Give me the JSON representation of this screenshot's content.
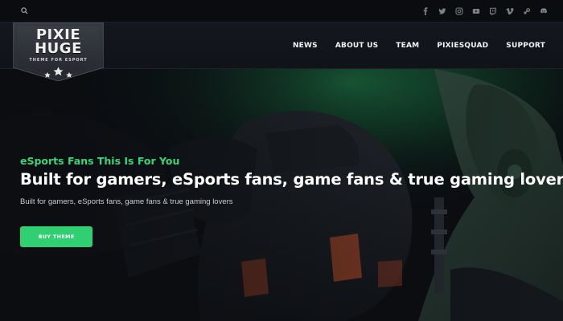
{
  "topbar": {
    "search_icon": "search-icon",
    "socials": [
      "facebook-icon",
      "twitter-icon",
      "instagram-icon",
      "youtube-icon",
      "twitch-icon",
      "vimeo-icon",
      "steam-icon",
      "discord-icon"
    ]
  },
  "logo": {
    "line1": "PIXIE",
    "line2": "HUGE",
    "tagline": "THEME FOR ESPORT"
  },
  "nav": {
    "items": [
      "NEWS",
      "ABOUT US",
      "TEAM",
      "PIXIESQUAD",
      "SUPPORT"
    ]
  },
  "hero": {
    "eyebrow": "eSports Fans This Is For You",
    "headline": "Built for gamers, eSports fans, game fans & true gaming lovers",
    "subline": "Built for gamers, eSports fans, game fans & true gaming lovers",
    "cta_label": "BUY THEME"
  },
  "colors": {
    "accent": "#2fcf72",
    "background": "#0d0f13",
    "header": "#14171d"
  }
}
